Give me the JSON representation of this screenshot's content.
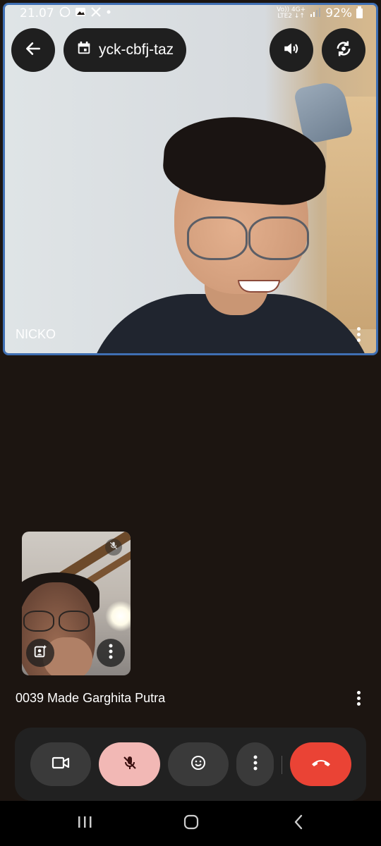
{
  "status_bar": {
    "time": "21.07",
    "network_top": "Vo)) 4G+",
    "network_bottom": "LTE2 ↓↑",
    "battery": "92%",
    "notification_icons": [
      "whatsapp-icon",
      "gallery-icon",
      "x-icon",
      "dot-icon"
    ]
  },
  "header": {
    "meeting_code": "yck-cbfj-taz",
    "icons": [
      "back-arrow-icon",
      "calendar-icon",
      "speaker-icon",
      "switch-camera-icon"
    ]
  },
  "main_tile": {
    "participant_name": "NICKO"
  },
  "self_tile": {
    "participant_name": "0039 Made Garghita Putra"
  },
  "controls": {
    "buttons": [
      "camera-icon",
      "mic-off-icon",
      "emoji-icon",
      "more-options-icon",
      "end-call-icon"
    ],
    "colors": {
      "mic_muted_bg": "#f2b8b5",
      "end_call_bg": "#ea4335",
      "tile_border": "#3f6fb3"
    }
  },
  "nav_bar": {
    "items": [
      "recents-icon",
      "home-icon",
      "back-icon"
    ]
  }
}
